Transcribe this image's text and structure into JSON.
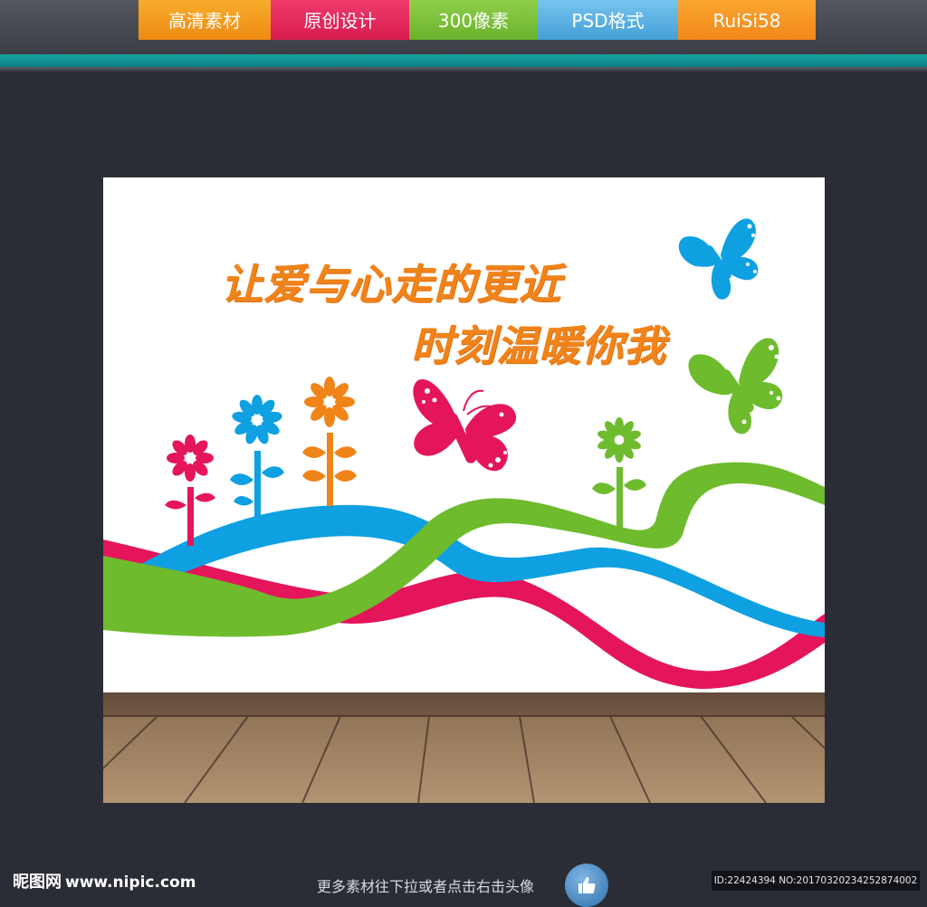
{
  "tabs": [
    {
      "label": "高清素材",
      "color": "#f39a1c"
    },
    {
      "label": "原创设计",
      "color": "#e8245b"
    },
    {
      "label": "300像素",
      "color": "#7cc23a"
    },
    {
      "label": "PSD格式",
      "color": "#58b1e3"
    },
    {
      "label": "RuiSi58",
      "color": "#f7941d"
    }
  ],
  "artwork": {
    "headline_line1": "让爱与心走的更近",
    "headline_line2": "时刻温暖你我",
    "colors": {
      "orange": "#f08419",
      "pink": "#e4155b",
      "blue": "#0fa0e2",
      "green": "#6fbb2e",
      "floor": "#a88866"
    },
    "icons": [
      "flower-icon",
      "butterfly-icon",
      "ribbon-wave"
    ]
  },
  "footer": {
    "logo_cn": "昵图网",
    "logo_site": "www.nipic.com",
    "hint": "更多素材往下拉或者点击右击头像",
    "thumb_icon": "thumbs-up-icon",
    "id_text": "ID:22424394 NO:20170320234252874002"
  }
}
